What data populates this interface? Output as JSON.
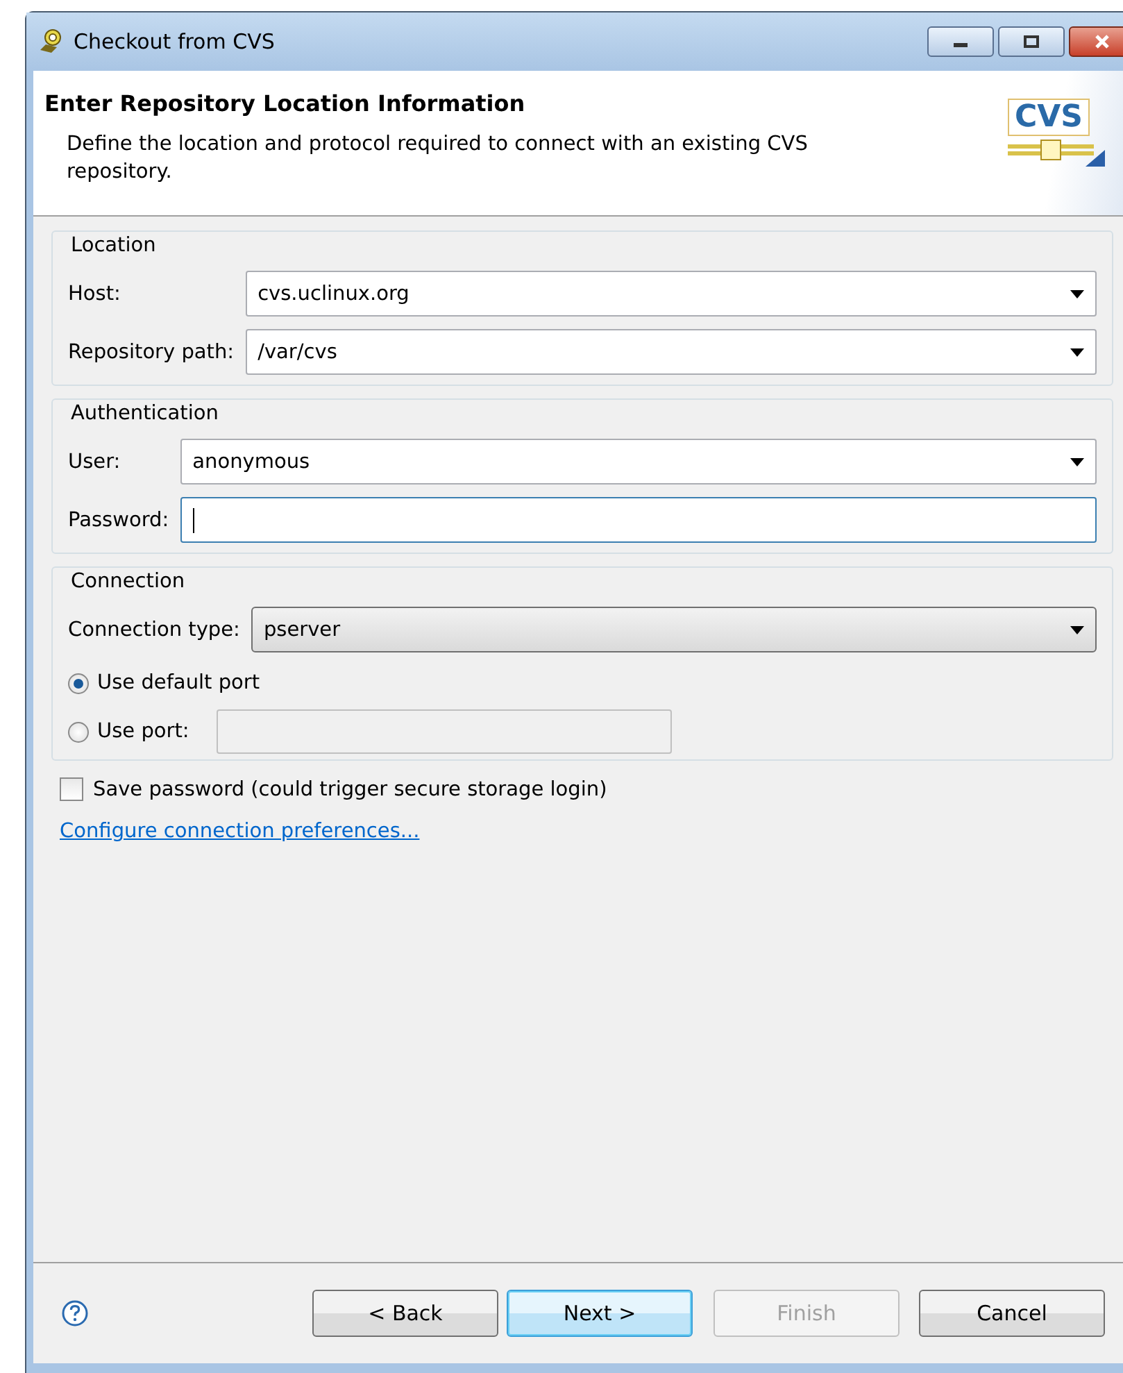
{
  "window": {
    "title": "Checkout from CVS"
  },
  "header": {
    "title": "Enter Repository Location Information",
    "description": "Define the location and protocol required to connect with an existing CVS repository.",
    "logo_text": "CVS"
  },
  "groups": [
    {
      "title": "Location",
      "rows": [
        {
          "kind": "combo",
          "label": "Host:",
          "value": "cvs.uclinux.org"
        },
        {
          "kind": "combo",
          "label": "Repository path:",
          "value": "/var/cvs"
        }
      ]
    },
    {
      "title": "Authentication",
      "rows": [
        {
          "kind": "combo",
          "label": "User:",
          "value": "anonymous"
        },
        {
          "kind": "text",
          "label": "Password:",
          "focused": true
        }
      ]
    },
    {
      "title": "Connection",
      "rows": [
        {
          "kind": "dropdown",
          "label": "Connection type:",
          "value": "pserver"
        },
        {
          "kind": "radio",
          "label": "Use default port",
          "selected": true
        },
        {
          "kind": "radio",
          "label": "Use port:",
          "selected": false,
          "field": {
            "disabled": true
          }
        }
      ]
    }
  ],
  "save_password": {
    "label": "Save password (could trigger secure storage login)",
    "checked": false
  },
  "link": "Configure connection preferences...",
  "buttons": [
    {
      "label": "< Back",
      "disabled": false,
      "default": false
    },
    {
      "label": "Next >",
      "disabled": false,
      "default": true
    },
    {
      "label": "Finish",
      "disabled": true,
      "default": false
    },
    {
      "label": "Cancel",
      "disabled": false,
      "default": false
    }
  ]
}
